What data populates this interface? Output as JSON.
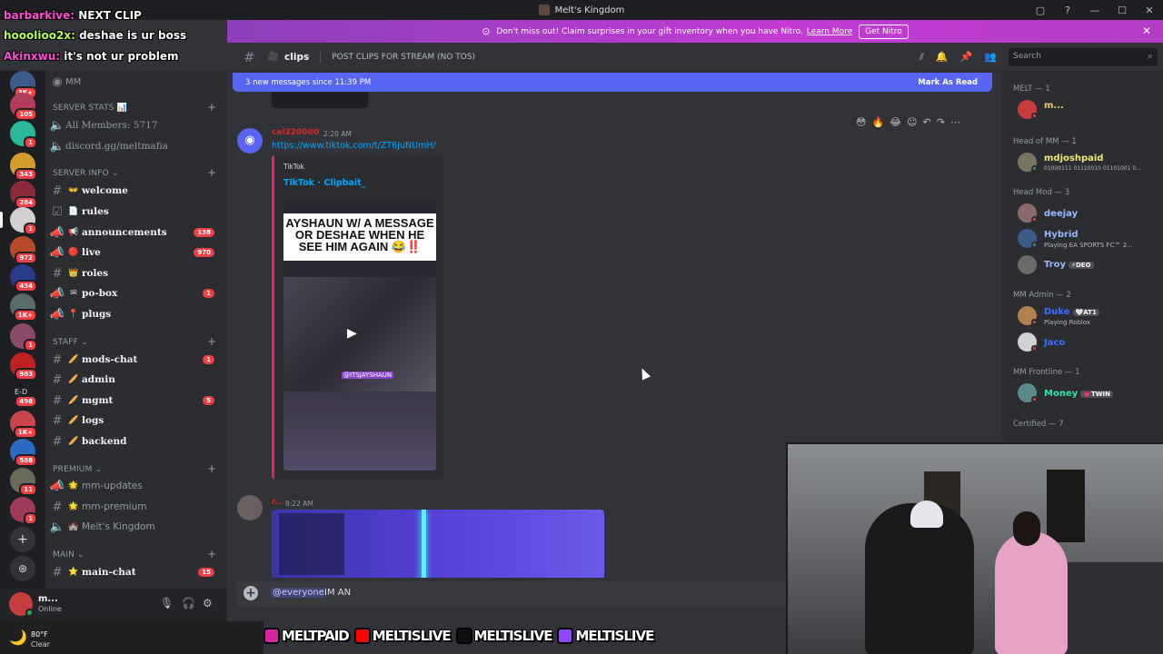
{
  "window": {
    "title": "Melt's Kingdom",
    "controls": [
      "▢",
      "?",
      "—",
      "☐",
      "✕"
    ]
  },
  "nitro_banner": {
    "text": "Don't miss out! Claim surprises in your gift inventory when you have Nitro.",
    "learn_more": "Learn More",
    "cta": "Get Nitro",
    "color": "#b43dc7"
  },
  "stream_chat": [
    {
      "user": "barbarkive:",
      "text": "NEXT CLIP"
    },
    {
      "user": "hooolioo2x:",
      "text": "deshae is ur boss"
    },
    {
      "user": "Akinxwu:",
      "text": "it's not ur problem"
    }
  ],
  "servers": [
    {
      "badge": "3K+"
    },
    {
      "badge": "105"
    },
    {
      "badge": "1"
    },
    {
      "badge": "343"
    },
    {
      "badge": "284"
    },
    {
      "badge": "1"
    },
    {
      "badge": "972"
    },
    {
      "badge": "434"
    },
    {
      "badge": "1K+"
    },
    {
      "badge": "1"
    },
    {
      "badge": "983"
    },
    {
      "badge": "498"
    },
    {
      "badge": "1K+"
    },
    {
      "badge": "588"
    },
    {
      "badge": "11"
    },
    {
      "badge": "1"
    }
  ],
  "rail_label": "E-D",
  "sidebar": {
    "top_item": "MM",
    "server_stats": {
      "label": "SERVER STATS 📊",
      "items": [
        "All Members: 5717",
        "discord.gg/meltmafia"
      ]
    },
    "server_info": {
      "label": "SERVER INFO",
      "channels": [
        {
          "emoji": "👐",
          "name": "welcome",
          "count": ""
        },
        {
          "emoji": "📄",
          "name": "rules",
          "count": ""
        },
        {
          "emoji": "📢",
          "name": "announcements",
          "count": "138"
        },
        {
          "emoji": "🔴",
          "name": "live",
          "count": "970"
        },
        {
          "emoji": "👑",
          "name": "roles",
          "count": ""
        },
        {
          "emoji": "✉",
          "name": "po-box",
          "count": "1"
        },
        {
          "emoji": "📍",
          "name": "plugs",
          "count": ""
        }
      ]
    },
    "staff": {
      "label": "STAFF",
      "channels": [
        {
          "emoji": "🥖",
          "name": "mods-chat",
          "count": "1"
        },
        {
          "emoji": "🥖",
          "name": "admin",
          "count": ""
        },
        {
          "emoji": "🥖",
          "name": "mgmt",
          "count": "5"
        },
        {
          "emoji": "🥖",
          "name": "logs",
          "count": ""
        },
        {
          "emoji": "🥖",
          "name": "backend",
          "count": ""
        }
      ]
    },
    "premium": {
      "label": "PREMIUM",
      "channels": [
        {
          "emoji": "🌟",
          "name": "mm-updates"
        },
        {
          "emoji": "🌟",
          "name": "mm-premium"
        },
        {
          "emoji": "🏰",
          "name": "Melt's Kingdom"
        }
      ]
    },
    "main": {
      "label": "MAIN",
      "channels": [
        {
          "emoji": "⭐",
          "name": "main-chat",
          "count": "15"
        }
      ]
    }
  },
  "user_panel": {
    "name": "m...",
    "status": "Online"
  },
  "channel_header": {
    "name": "clips",
    "topic": "POST CLIPS FOR STREAM (NO TOS)"
  },
  "search": {
    "placeholder": "Search"
  },
  "new_messages": {
    "text": "3 new messages since 11:39 PM",
    "action": "Mark As Read"
  },
  "messages": [
    {
      "author": "cel220000",
      "author_color": "#e02424",
      "time": "2:20 AM",
      "link": "https://www.tiktok.com/t/ZT6JuNUmH/",
      "embed": {
        "provider": "TikTok",
        "title": "TikTok · Clipbait_",
        "caption": "AYSHAUN W/ A MESSAGE OR DESHAE WHEN HE SEE HIM AGAIN 😂‼️",
        "tag": "@ITSJAYSHAUN"
      }
    },
    {
      "author": "r...",
      "author_color": "#e02424",
      "time": "8:22 AM"
    }
  ],
  "composer": {
    "mention": "@everyone",
    "text": "IM AN"
  },
  "members": {
    "groups": [
      {
        "role": "MELT — 1",
        "members": [
          {
            "name": "m...",
            "color": "#f0c674",
            "sub": "",
            "tag": ""
          }
        ]
      },
      {
        "role": "Head of MM — 1",
        "members": [
          {
            "name": "mdjoshpaid",
            "color": "#f0e97a",
            "sub": "01000111 01110010 01101001 0...",
            "tag": ""
          }
        ]
      },
      {
        "role": "Head Mod — 3",
        "members": [
          {
            "name": "deejay",
            "color": "#9ab7ff",
            "sub": "",
            "tag": ""
          },
          {
            "name": "Hybrid",
            "color": "#9ab7ff",
            "sub": "Playing EA SPORTS FC™ 2...",
            "tag": ""
          },
          {
            "name": "Troy",
            "color": "#9ab7ff",
            "sub": "",
            "tag": "⚡DEO"
          }
        ]
      },
      {
        "role": "MM Admin — 2",
        "members": [
          {
            "name": "Duke",
            "color": "#3d6cff",
            "sub": "Playing Roblox",
            "tag": "🤍AT1"
          },
          {
            "name": "Jaco",
            "color": "#3d6cff",
            "sub": "",
            "tag": ""
          }
        ]
      },
      {
        "role": "MM Frontline — 1",
        "members": [
          {
            "name": "Money",
            "color": "#2ee6a8",
            "sub": "",
            "tag": "💗TWIN"
          }
        ]
      },
      {
        "role": "Certified — 7",
        "members": []
      }
    ]
  },
  "stream_banner": [
    {
      "text": "MELTPAID",
      "icon": "instagram",
      "color": "#d6249f"
    },
    {
      "text": "MELTISLIVE",
      "icon": "youtube",
      "color": "#ff0000"
    },
    {
      "text": "MELTISLIVE",
      "icon": "tiktok",
      "color": "#000000"
    },
    {
      "text": "MELTISLIVE",
      "icon": "twitch",
      "color": "#9146ff"
    }
  ],
  "weather": {
    "temp": "80°F",
    "condition": "Clear"
  }
}
